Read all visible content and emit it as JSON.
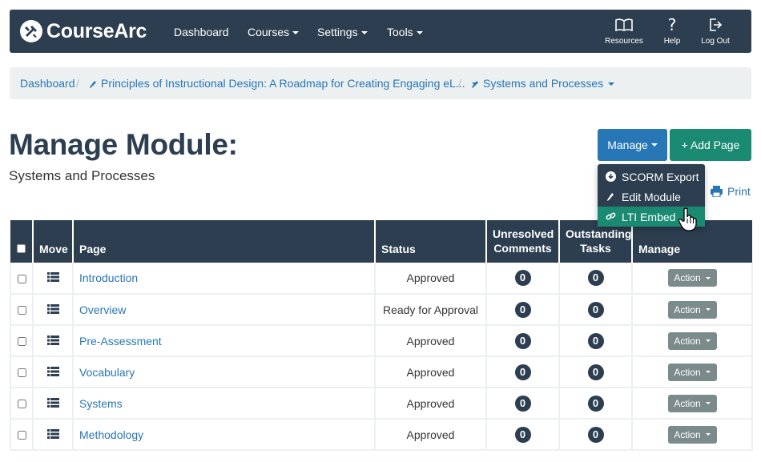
{
  "nav": {
    "brand": "CourseArc",
    "links": [
      {
        "label": "Dashboard",
        "has_caret": false
      },
      {
        "label": "Courses",
        "has_caret": true
      },
      {
        "label": "Settings",
        "has_caret": true
      },
      {
        "label": "Tools",
        "has_caret": true
      }
    ],
    "right": [
      {
        "label": "Resources",
        "icon": "book-icon"
      },
      {
        "label": "Help",
        "icon": "question-icon"
      },
      {
        "label": "Log Out",
        "icon": "logout-icon"
      }
    ]
  },
  "breadcrumb": {
    "home": "Dashboard",
    "course": "Principles of Instructional Design: A Roadmap for Creating Engaging eL...",
    "module": "Systems and Processes"
  },
  "page": {
    "title": "Manage Module:",
    "subtitle": "Systems and Processes"
  },
  "actions": {
    "manage_label": "Manage",
    "add_page_label": "+ Add Page",
    "print_label": "Print"
  },
  "manage_menu": [
    {
      "label": "SCORM Export",
      "icon": "download-icon",
      "active": false
    },
    {
      "label": "Edit Module",
      "icon": "pencil-icon",
      "active": false
    },
    {
      "label": "LTI Embed",
      "icon": "link-icon",
      "active": true
    }
  ],
  "table": {
    "headers": {
      "move": "Move",
      "page": "Page",
      "status": "Status",
      "unresolved_1": "Unresolved",
      "unresolved_2": "Comments",
      "outstanding_1": "Outstanding",
      "outstanding_2": "Tasks",
      "manage": "Manage"
    },
    "action_label": "Action",
    "rows": [
      {
        "page": "Introduction",
        "status": "Approved",
        "comments": "0",
        "tasks": "0"
      },
      {
        "page": "Overview",
        "status": "Ready for Approval",
        "comments": "0",
        "tasks": "0"
      },
      {
        "page": "Pre-Assessment",
        "status": "Approved",
        "comments": "0",
        "tasks": "0"
      },
      {
        "page": "Vocabulary",
        "status": "Approved",
        "comments": "0",
        "tasks": "0"
      },
      {
        "page": "Systems",
        "status": "Approved",
        "comments": "0",
        "tasks": "0"
      },
      {
        "page": "Methodology",
        "status": "Approved",
        "comments": "0",
        "tasks": "0"
      }
    ]
  },
  "colors": {
    "navbar": "#2c3e50",
    "link": "#2776b6",
    "primary": "#2776b6",
    "success": "#1a8a73",
    "breadcrumb_bg": "#ecf0f1",
    "action_btn": "#7b8a8b"
  }
}
